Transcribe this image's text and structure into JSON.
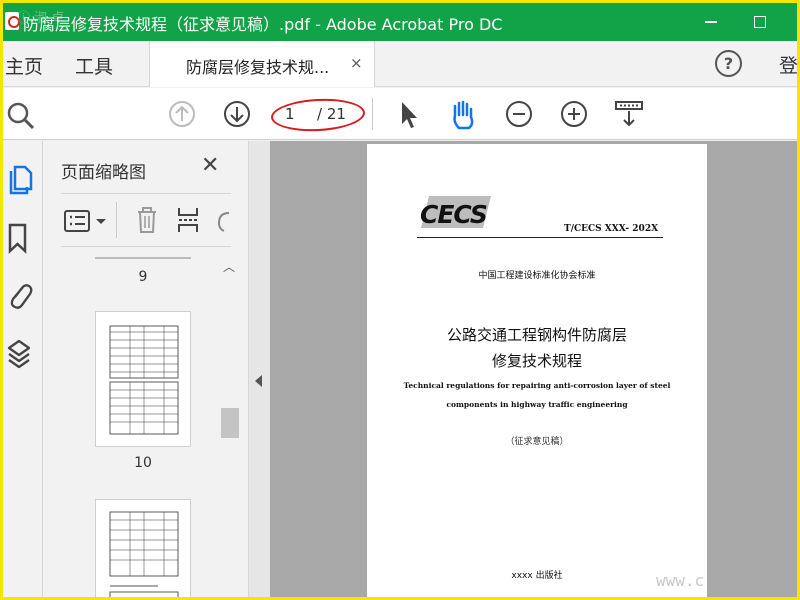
{
  "window": {
    "title": "防腐层修复技术规程（征求意见稿）.pdf - Adobe Acrobat Pro DC"
  },
  "tabs": {
    "home": "主页",
    "tools": "工具",
    "document": "防腐层修复技术规...",
    "close_glyph": "×",
    "help_glyph": "?",
    "login": "登"
  },
  "toolbar": {
    "current_page": "1",
    "total_pages": "/ 21"
  },
  "panel": {
    "title": "页面缩略图",
    "close_glyph": "✕",
    "thumbnails": [
      {
        "label": "9"
      },
      {
        "label": "10"
      }
    ]
  },
  "document": {
    "logo": "CECS",
    "standard_code": "T/CECS XXX- 202X",
    "association": "中国工程建设标准化协会标准",
    "title_line1": "公路交通工程钢构件防腐层",
    "title_line2": "修复技术规程",
    "english_line1": "Technical regulations for repairing anti-corrosion layer of steel",
    "english_line2": "components in highway traffic engineering",
    "draft_note": "（征求意见稿）",
    "publisher": "xxxx 出版社"
  },
  "watermark": "www.c",
  "corner_watermark": "ⓘ 淑 卓"
}
